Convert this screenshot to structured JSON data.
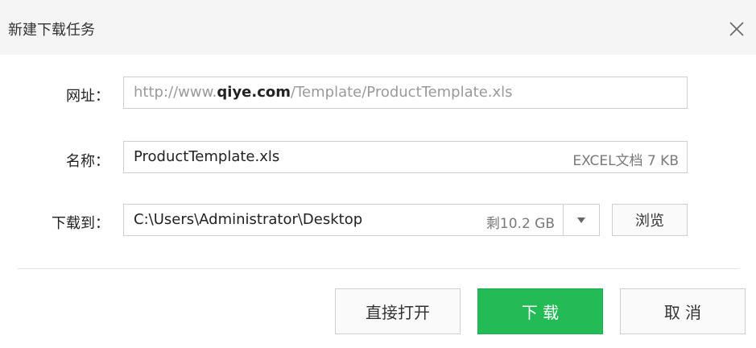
{
  "dialog": {
    "title": "新建下载任务"
  },
  "url_row": {
    "label": "网址：",
    "value_prefix": "http://www.",
    "value_domain": "qiye.com",
    "value_path": "/Template/ProductTemplate.xls"
  },
  "name_row": {
    "label": "名称：",
    "value": "ProductTemplate.xls",
    "file_info": "EXCEL文档 7 KB"
  },
  "save_row": {
    "label": "下载到：",
    "path": "C:\\Users\\Administrator\\Desktop",
    "free_space": "剩10.2 GB",
    "browse_label": "浏览"
  },
  "actions": {
    "open_label": "直接打开",
    "download_label": "下 载",
    "cancel_label": "取 消"
  },
  "icons": {
    "close": "close-icon",
    "dropdown": "chevron-down-icon"
  },
  "colors": {
    "primary": "#22bb55",
    "title_bar": "#f5f5f5"
  }
}
